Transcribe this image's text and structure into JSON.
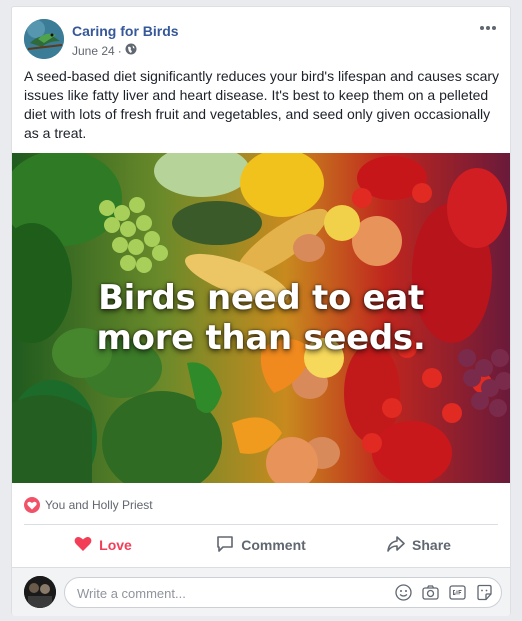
{
  "post": {
    "page_name": "Caring for Birds",
    "date": "June 24",
    "separator": "·",
    "text": "A seed-based diet significantly reduces your bird's lifespan and causes scary issues like fatty liver and heart disease. It's best to keep them on a pelleted diet with lots of fresh fruit and vegetables, and seed only given occasionally as a treat.",
    "image": {
      "caption_line1": "Birds need to eat",
      "caption_line2": "more than seeds."
    }
  },
  "reactions": {
    "summary": "You and Holly Priest",
    "icon": "heart-icon",
    "color": "#f25268"
  },
  "actions": [
    {
      "label": "Love",
      "icon": "heart-icon",
      "color": "#f33e58"
    },
    {
      "label": "Comment",
      "icon": "comment-icon"
    },
    {
      "label": "Share",
      "icon": "share-icon"
    }
  ],
  "comment_box": {
    "placeholder": "Write a comment...",
    "icons": [
      "emoji-icon",
      "camera-icon",
      "gif-icon",
      "sticker-icon"
    ]
  },
  "colors": {
    "link": "#365899",
    "love": "#f33e58"
  }
}
